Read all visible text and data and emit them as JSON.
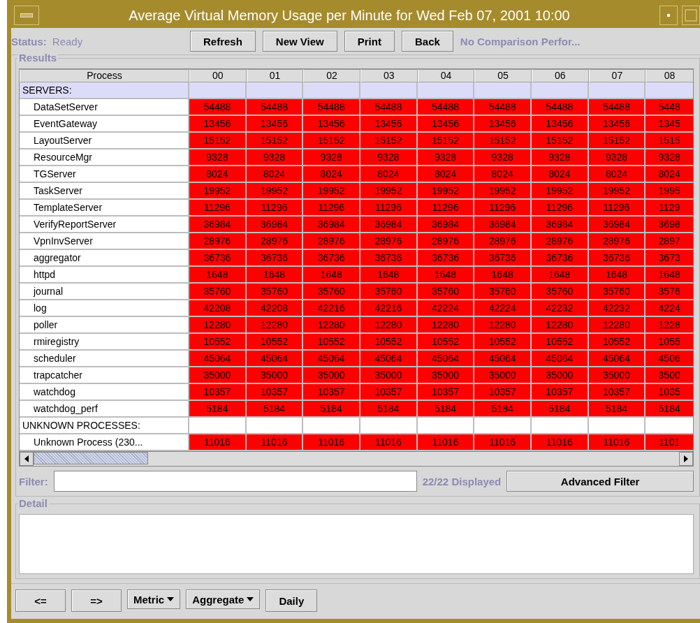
{
  "window": {
    "title": "Average Virtual Memory Usage per Minute for Wed Feb 07, 2001 10:00"
  },
  "toolbar": {
    "status_label": "Status:",
    "status_value": "Ready",
    "buttons": [
      "Refresh",
      "New View",
      "Print",
      "Back"
    ],
    "comparison": "No Comparison Perfor..."
  },
  "results": {
    "title": "Results",
    "table": {
      "columns": [
        "Process",
        "00",
        "01",
        "02",
        "03",
        "04",
        "05",
        "06",
        "07",
        "08"
      ],
      "rows": [
        {
          "kind": "group",
          "name": "SERVERS:",
          "selected": true,
          "values": []
        },
        {
          "kind": "process",
          "name": "DataSetServer",
          "selected": false,
          "values": [
            "54488",
            "54488",
            "54488",
            "54488",
            "54488",
            "54488",
            "54488",
            "54488",
            "5448"
          ]
        },
        {
          "kind": "process",
          "name": "EventGateway",
          "selected": false,
          "values": [
            "13456",
            "13456",
            "13456",
            "13456",
            "13456",
            "13456",
            "13456",
            "13456",
            "1345"
          ]
        },
        {
          "kind": "process",
          "name": "LayoutServer",
          "selected": false,
          "values": [
            "15152",
            "15152",
            "15152",
            "15152",
            "15152",
            "15152",
            "15152",
            "15152",
            "1515"
          ]
        },
        {
          "kind": "process",
          "name": "ResourceMgr",
          "selected": false,
          "values": [
            "9328",
            "9328",
            "9328",
            "9328",
            "9328",
            "9328",
            "9328",
            "9328",
            "9328"
          ]
        },
        {
          "kind": "process",
          "name": "TGServer",
          "selected": false,
          "values": [
            "8024",
            "8024",
            "8024",
            "8024",
            "8024",
            "8024",
            "8024",
            "8024",
            "8024"
          ]
        },
        {
          "kind": "process",
          "name": "TaskServer",
          "selected": false,
          "values": [
            "19952",
            "19952",
            "19952",
            "19952",
            "19952",
            "19952",
            "19952",
            "19952",
            "1995"
          ]
        },
        {
          "kind": "process",
          "name": "TemplateServer",
          "selected": false,
          "values": [
            "11296",
            "11296",
            "11296",
            "11296",
            "11296",
            "11296",
            "11296",
            "11296",
            "1129"
          ]
        },
        {
          "kind": "process",
          "name": "VerifyReportServer",
          "selected": false,
          "values": [
            "36984",
            "36984",
            "36984",
            "36984",
            "36984",
            "36984",
            "36984",
            "36984",
            "3698"
          ]
        },
        {
          "kind": "process",
          "name": "VpnInvServer",
          "selected": false,
          "values": [
            "28976",
            "28976",
            "28976",
            "28976",
            "28976",
            "28976",
            "28976",
            "28976",
            "2897"
          ]
        },
        {
          "kind": "process",
          "name": "aggregator",
          "selected": false,
          "values": [
            "36736",
            "36736",
            "36736",
            "36736",
            "36736",
            "36736",
            "36736",
            "36736",
            "3673"
          ]
        },
        {
          "kind": "process",
          "name": "httpd",
          "selected": false,
          "values": [
            "1648",
            "1648",
            "1648",
            "1648",
            "1648",
            "1648",
            "1648",
            "1648",
            "1648"
          ]
        },
        {
          "kind": "process",
          "name": "journal",
          "selected": false,
          "values": [
            "35760",
            "35760",
            "35760",
            "35760",
            "35760",
            "35760",
            "35760",
            "35760",
            "3576"
          ]
        },
        {
          "kind": "process",
          "name": "log",
          "selected": false,
          "values": [
            "42208",
            "42208",
            "42216",
            "42216",
            "42224",
            "42224",
            "42232",
            "42232",
            "4224"
          ]
        },
        {
          "kind": "process",
          "name": "poller",
          "selected": false,
          "values": [
            "12280",
            "12280",
            "12280",
            "12280",
            "12280",
            "12280",
            "12280",
            "12280",
            "1228"
          ]
        },
        {
          "kind": "process",
          "name": "rmiregistry",
          "selected": false,
          "values": [
            "10552",
            "10552",
            "10552",
            "10552",
            "10552",
            "10552",
            "10552",
            "10552",
            "1055"
          ]
        },
        {
          "kind": "process",
          "name": "scheduler",
          "selected": false,
          "values": [
            "45064",
            "45064",
            "45064",
            "45064",
            "45064",
            "45064",
            "45064",
            "45064",
            "4506"
          ]
        },
        {
          "kind": "process",
          "name": "trapcatcher",
          "selected": false,
          "values": [
            "35000",
            "35000",
            "35000",
            "35000",
            "35000",
            "35000",
            "35000",
            "35000",
            "3500"
          ]
        },
        {
          "kind": "process",
          "name": "watchdog",
          "selected": false,
          "values": [
            "10357",
            "10357",
            "10357",
            "10357",
            "10357",
            "10357",
            "10357",
            "10357",
            "1035"
          ]
        },
        {
          "kind": "process",
          "name": "watchdog_perf",
          "selected": false,
          "values": [
            "5184",
            "5184",
            "5184",
            "5184",
            "5184",
            "5184",
            "5184",
            "5184",
            "5184"
          ]
        },
        {
          "kind": "group",
          "name": "UNKNOWN PROCESSES:",
          "selected": false,
          "values": []
        },
        {
          "kind": "process",
          "name": "Unknown Process (230...",
          "selected": false,
          "values": [
            "11016",
            "11016",
            "11016",
            "11016",
            "11016",
            "11016",
            "11016",
            "11016",
            "1101"
          ]
        }
      ]
    },
    "filter": {
      "label": "Filter:",
      "count": "22/22 Displayed",
      "button": "Advanced Filter"
    }
  },
  "detail": {
    "title": "Detail"
  },
  "bottom_bar": [
    {
      "kind": "button",
      "label": "<="
    },
    {
      "kind": "button",
      "label": "=>"
    },
    {
      "kind": "menu",
      "label": "Metric"
    },
    {
      "kind": "menu",
      "label": "Aggregate"
    },
    {
      "kind": "button",
      "label": "Daily"
    }
  ]
}
